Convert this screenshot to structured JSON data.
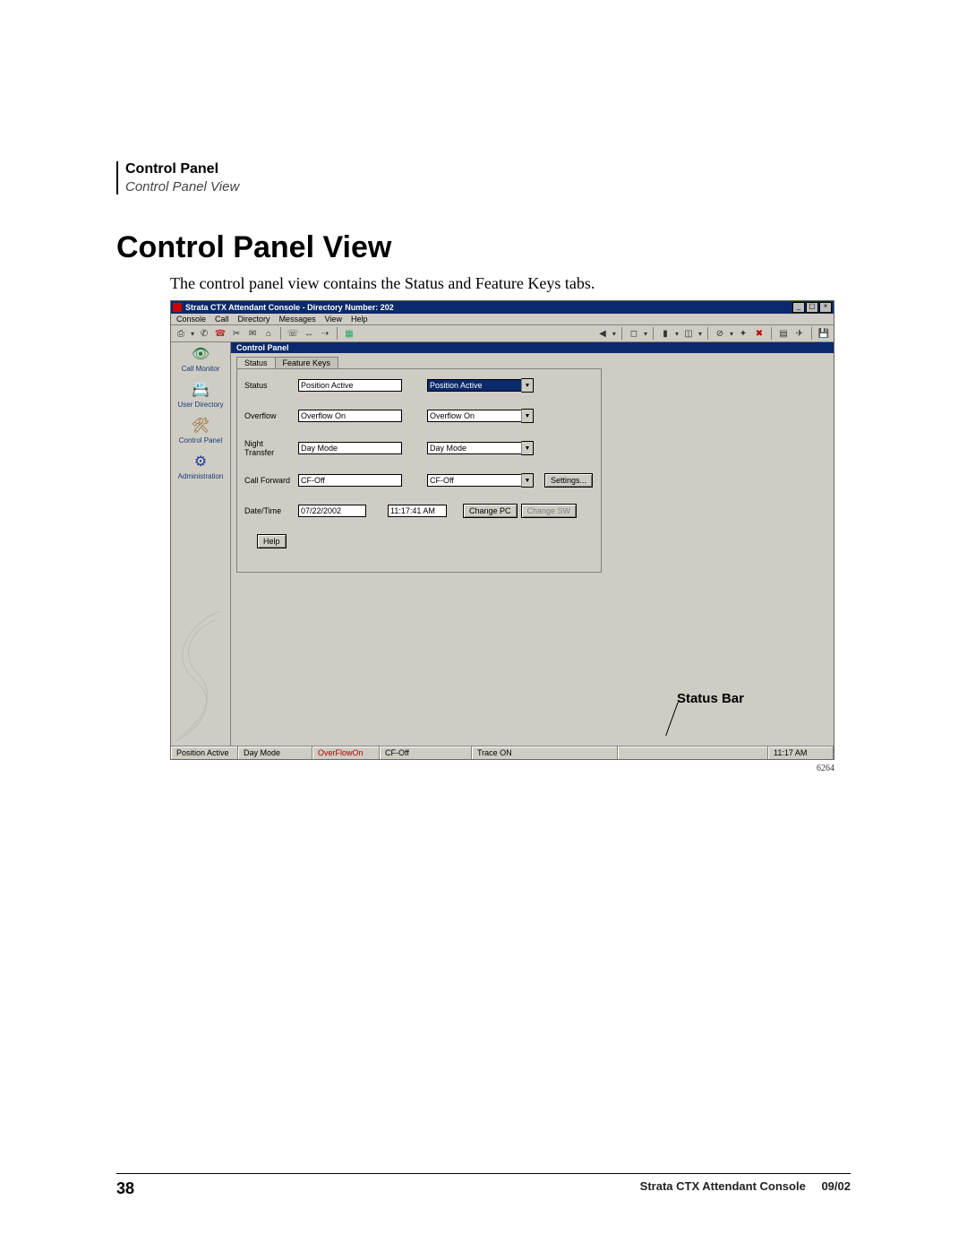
{
  "header": {
    "title": "Control Panel",
    "subtitle": "Control Panel View"
  },
  "main_heading": "Control Panel View",
  "intro_text": "The control panel view contains the Status and Feature Keys tabs.",
  "window": {
    "title": "Strata CTX Attendant Console - Directory Number: 202",
    "menu": [
      "Console",
      "Call",
      "Directory",
      "Messages",
      "View",
      "Help"
    ],
    "panel_title": "Control Panel",
    "sidebar": [
      {
        "label": "Call Monitor"
      },
      {
        "label": "User Directory"
      },
      {
        "label": "Control Panel"
      },
      {
        "label": "Administration"
      }
    ],
    "tabs": {
      "active": "Status",
      "inactive": "Feature Keys"
    },
    "fields": {
      "status": {
        "label": "Status",
        "value": "Position Active",
        "dd": "Position Active"
      },
      "overflow": {
        "label": "Overflow",
        "value": "Overflow On",
        "dd": "Overflow On"
      },
      "night": {
        "label": "Night Transfer",
        "value": "Day Mode",
        "dd": "Day Mode"
      },
      "cf": {
        "label": "Call Forward",
        "value": "CF-Off",
        "dd": "CF-Off",
        "btn": "Settings..."
      },
      "dt": {
        "label": "Date/Time",
        "date": "07/22/2002",
        "time": "11:17:41 AM",
        "btn1": "Change PC",
        "btn2": "Change SW"
      },
      "help": "Help"
    },
    "status_label": "Status Bar",
    "statusbar": {
      "pos": "Position Active",
      "day": "Day Mode",
      "ovf": "OverFlowOn",
      "cf": "CF-Off",
      "trace": "Trace ON",
      "time": "11:17 AM"
    }
  },
  "figure_id": "6264",
  "footer": {
    "page": "38",
    "doc": "Strata CTX Attendant Console",
    "date": "09/02"
  }
}
